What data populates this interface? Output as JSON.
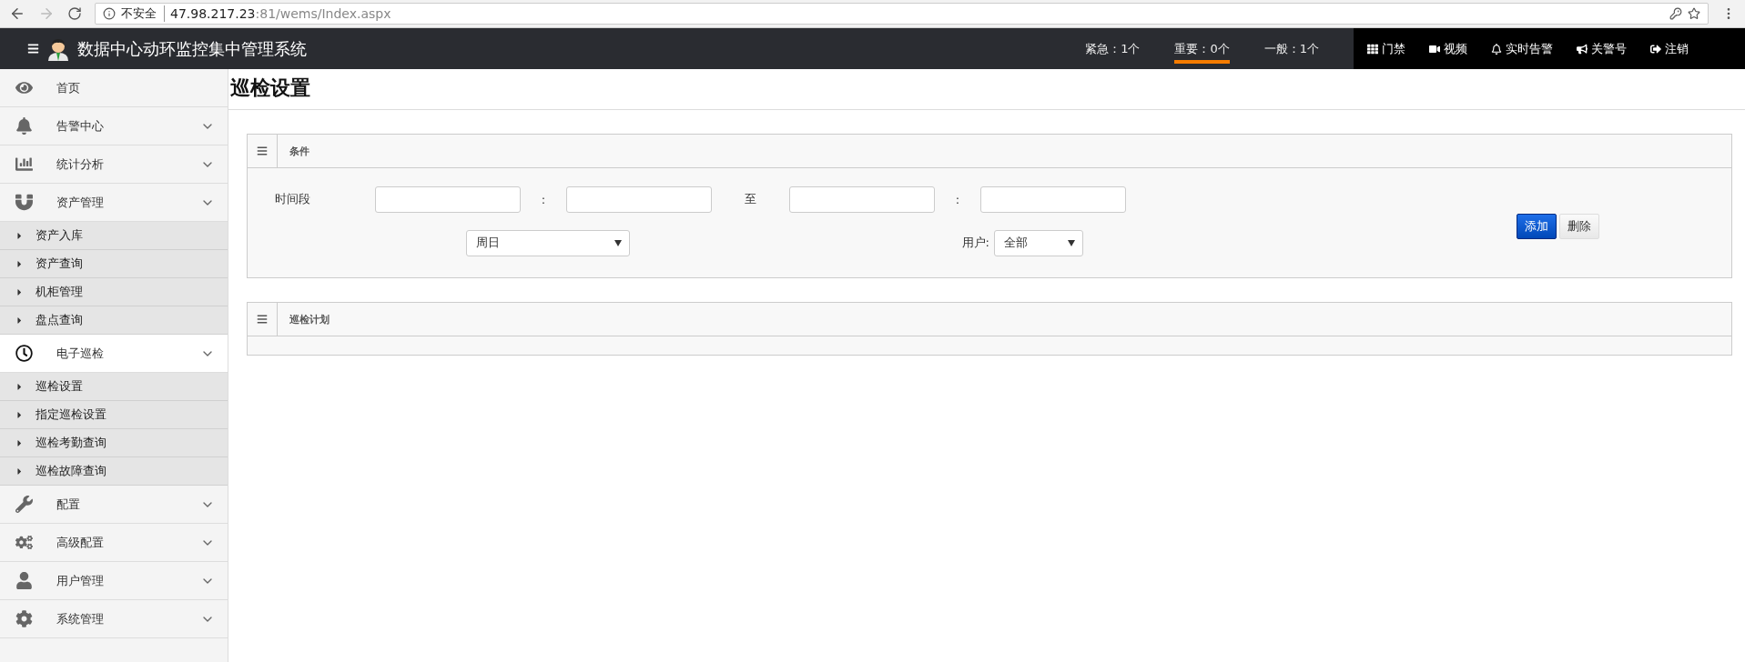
{
  "browser": {
    "security": "不安全",
    "url_host": "47.98.217.23",
    "url_path": ":81/wems/Index.aspx"
  },
  "header": {
    "title": "数据中心动环监控集中管理系统",
    "alarms": [
      {
        "label": "紧急：1个",
        "selected": false
      },
      {
        "label": "重要：0个",
        "selected": true
      },
      {
        "label": "一般：1个",
        "selected": false
      }
    ],
    "actions": [
      "门禁",
      "视频",
      "实时告警",
      "关警号",
      "注销"
    ]
  },
  "sidebar": {
    "items": [
      {
        "label": "首页",
        "selected": false,
        "kind": "link"
      },
      {
        "label": "告警中心",
        "selected": false,
        "kind": "menu"
      },
      {
        "label": "统计分析",
        "selected": false,
        "kind": "menu"
      },
      {
        "label": "资产管理",
        "selected": false,
        "kind": "menu",
        "children": [
          "资产入库",
          "资产查询",
          "机柜管理",
          "盘点查询"
        ]
      },
      {
        "label": "电子巡检",
        "selected": true,
        "kind": "menu",
        "children": [
          "巡检设置",
          "指定巡检设置",
          "巡检考勤查询",
          "巡检故障查询"
        ]
      },
      {
        "label": "配置",
        "selected": false,
        "kind": "menu"
      },
      {
        "label": "高级配置",
        "selected": false,
        "kind": "menu"
      },
      {
        "label": "用户管理",
        "selected": false,
        "kind": "menu"
      },
      {
        "label": "系统管理",
        "selected": false,
        "kind": "menu"
      }
    ]
  },
  "page_title": "巡检设置",
  "conditions": {
    "title": "条件",
    "time_label": "时间段",
    "separator_1": ":",
    "to_label": "至",
    "separator_2": ":",
    "weekday": "周日",
    "user_label": "用户:",
    "user": "全部",
    "buttons": [
      {
        "label": "添加",
        "kind": "primary"
      },
      {
        "label": "删除",
        "kind": "default"
      }
    ]
  },
  "plan": {
    "title": "巡检计划"
  }
}
